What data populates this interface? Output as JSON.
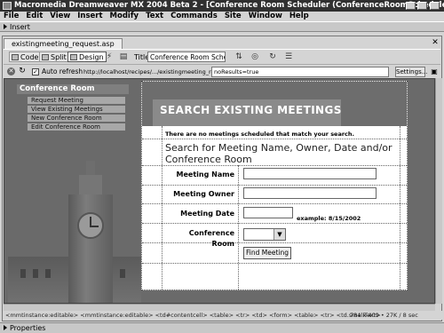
{
  "window": {
    "title": "Macromedia Dreamweaver MX 2004 Beta 2 - [Conference Room Scheduler (ConferenceRoomScheduler_VBS/e..."
  },
  "menu": [
    "File",
    "Edit",
    "View",
    "Insert",
    "Modify",
    "Text",
    "Commands",
    "Site",
    "Window",
    "Help"
  ],
  "insert_panel": {
    "label": "Insert"
  },
  "document": {
    "tab_label": "existingmeeting_request.asp",
    "toolbar": {
      "code_label": "Code",
      "split_label": "Split",
      "design_label": "Design",
      "title_label": "Title:",
      "title_value": "Conference Room Scheduler"
    },
    "live_bar": {
      "autorefresh_label": "Auto refresh",
      "url": "http://localhost/recipes/.../existingmeeting_request.asp",
      "params": "noResults=true",
      "settings_label": "Settings..."
    }
  },
  "page": {
    "nav": {
      "header": "Conference Room",
      "items": [
        "Request Meeting",
        "View Existing Meetings",
        "New Conference Room",
        "Edit Conference Room"
      ]
    },
    "panel_title": "SEARCH EXISTING MEETINGS",
    "no_meetings_msg": "There are no meetings scheduled that match your search.",
    "search_heading": "Search for Meeting Name, Owner, Date and/or Conference Room",
    "fields": {
      "meeting_name": "Meeting Name",
      "meeting_owner": "Meeting Owner",
      "meeting_date": "Meeting Date",
      "conference_room": "Conference Room"
    },
    "date_example": "example: 8/15/2002",
    "find_button": "Find Meeting"
  },
  "status": {
    "tag_path": "<mmtinstance:editable> <mmtinstance:editable> <td#contentcell> <table> <tr> <td> <form> <table> <tr> <td.smallText>",
    "size_info": "784 x 409 • 27K / 8 sec"
  },
  "properties_panel": {
    "label": "Properties"
  },
  "icons": {
    "stop": "stop-icon",
    "refresh": "refresh-icon",
    "close": "close-icon"
  }
}
